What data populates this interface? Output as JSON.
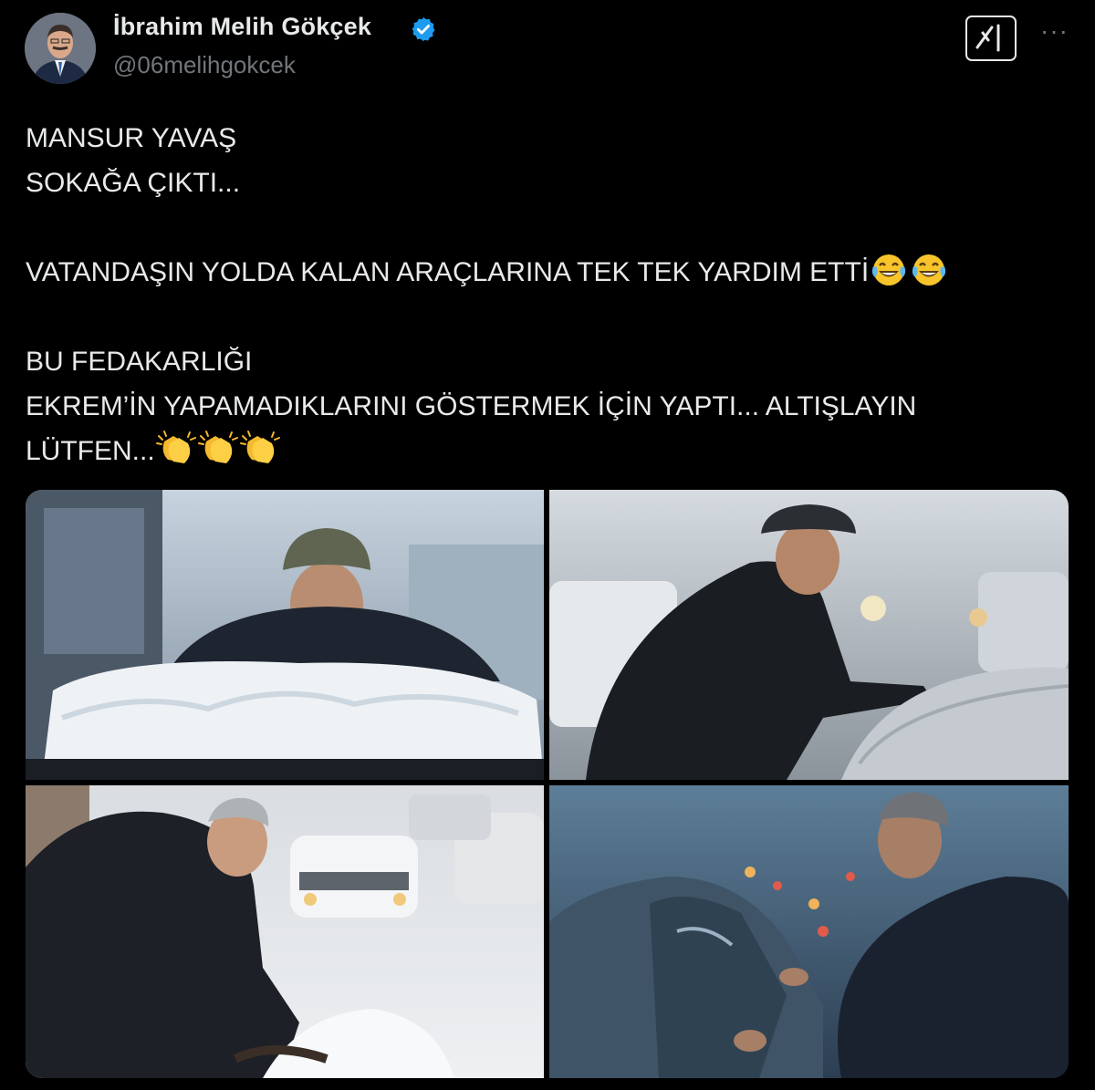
{
  "author": {
    "display_name": "İbrahim Melih Gökçek",
    "handle": "@06melihgokcek"
  },
  "icons": {
    "verified": "verified-badge-icon",
    "grok": "grok-icon",
    "more": "more-options-icon",
    "laugh_emoji": "face-with-tears-of-joy-emoji",
    "clap_emoji": "clapping-hands-emoji"
  },
  "tweet": {
    "line1": "MANSUR YAVAŞ",
    "line2": "SOKAĞA ÇIKTI...",
    "line3": "VATANDAŞIN YOLDA KALAN ARAÇLARINA TEK TEK YARDIM ETTİ",
    "line4": "BU FEDAKARLIĞI",
    "line5": "EKREM’İN YAPAMADIKLARINI GÖSTERMEK İÇİN YAPTI... ALTIŞLAYIN",
    "line6": "LÜTFEN..."
  },
  "colors": {
    "background": "#000000",
    "text": "#e7e9ea",
    "secondary_text": "#71767b",
    "verified_blue": "#1d9bf0"
  },
  "media": {
    "photo_count": 4
  }
}
